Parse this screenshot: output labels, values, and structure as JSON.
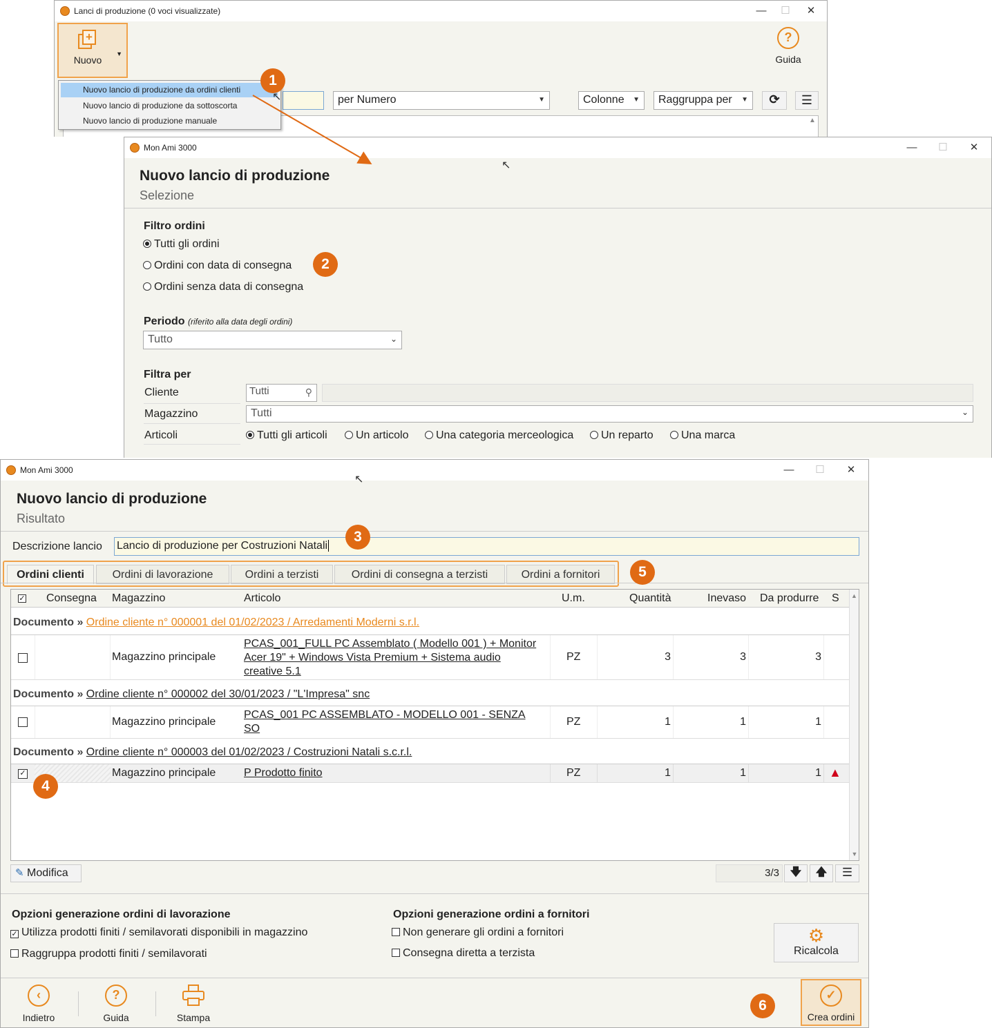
{
  "win1": {
    "title": "Lanci di produzione (0 voci visualizzate)",
    "new_button": "Nuovo",
    "help_button": "Guida",
    "menu_items": [
      "Nuovo lancio di produzione da ordini clienti",
      "Nuovo lancio di produzione da sottoscorta",
      "Nuovo lancio di produzione manuale"
    ],
    "sort_select": "per Numero",
    "columns_button": "Colonne",
    "group_button": "Raggruppa per"
  },
  "win2": {
    "title": "Mon Ami 3000",
    "heading": "Nuovo lancio di produzione",
    "subheading": "Selezione",
    "filter_title": "Filtro ordini",
    "filter_options": [
      "Tutti gli ordini",
      "Ordini con data di consegna",
      "Ordini senza data di consegna"
    ],
    "period_label": "Periodo",
    "period_note": "(riferito alla data degli ordini)",
    "period_value": "Tutto",
    "filter_by_title": "Filtra per",
    "client_label": "Cliente",
    "client_value": "Tutti",
    "warehouse_label": "Magazzino",
    "warehouse_value": "Tutti",
    "articles_label": "Articoli",
    "article_options": [
      "Tutti gli articoli",
      "Un articolo",
      "Una categoria merceologica",
      "Un reparto",
      "Una marca"
    ]
  },
  "win3": {
    "title": "Mon Ami 3000",
    "heading": "Nuovo lancio di produzione",
    "subheading": "Risultato",
    "desc_label": "Descrizione lancio",
    "desc_value": "Lancio di produzione per Costruzioni Natali",
    "tabs": [
      "Ordini clienti",
      "Ordini di lavorazione",
      "Ordini a terzisti",
      "Ordini di consegna a terzisti",
      "Ordini a fornitori"
    ],
    "columns": [
      "Consegna",
      "Magazzino",
      "Articolo",
      "U.m.",
      "Quantità",
      "Inevaso",
      "Da produrre",
      "S"
    ],
    "doc_prefix": "Documento »",
    "groups": [
      {
        "doc": "Ordine cliente n° 000001 del 01/02/2023 / Arredamenti Moderni s.r.l.",
        "warehouse": "Magazzino principale",
        "article_lines": [
          "PCAS_001_FULL PC Assemblato ( Modello 001 ) + Monitor",
          "Acer 19\" + Windows Vista Premium + Sistema audio",
          "creative 5.1"
        ],
        "um": "PZ",
        "qty": "3",
        "inevaso": "3",
        "produce": "3"
      },
      {
        "doc": "Ordine cliente n° 000002 del 30/01/2023 / \"L'Impresa\" snc",
        "warehouse": "Magazzino principale",
        "article_lines": [
          "PCAS_001 PC ASSEMBLATO - MODELLO 001 - SENZA",
          "SO"
        ],
        "um": "PZ",
        "qty": "1",
        "inevaso": "1",
        "produce": "1"
      },
      {
        "doc": "Ordine cliente n° 000003 del 01/02/2023 / Costruzioni Natali s.c.r.l.",
        "warehouse": "Magazzino principale",
        "article_lines": [
          "P Prodotto finito"
        ],
        "um": "PZ",
        "qty": "1",
        "inevaso": "1",
        "produce": "1"
      }
    ],
    "edit_button": "Modifica",
    "pager": "3/3",
    "work_opts_title": "Opzioni generazione ordini di lavorazione",
    "work_opts": [
      "Utilizza prodotti finiti / semilavorati disponibili in magazzino",
      "Raggruppa prodotti finiti / semilavorati"
    ],
    "supplier_opts_title": "Opzioni generazione ordini a fornitori",
    "supplier_opts": [
      "Non generare gli ordini a fornitori",
      "Consegna diretta a terzista"
    ],
    "recalc_button": "Ricalcola",
    "back_button": "Indietro",
    "help_button": "Guida",
    "print_button": "Stampa",
    "create_button": "Crea ordini"
  },
  "badges": [
    "1",
    "2",
    "3",
    "4",
    "5",
    "6"
  ],
  "colors": {
    "accent": "#e06a14",
    "highlight_border": "#f0a24a",
    "menu_selected": "#a9d1f5",
    "warning": "#d0021b"
  }
}
